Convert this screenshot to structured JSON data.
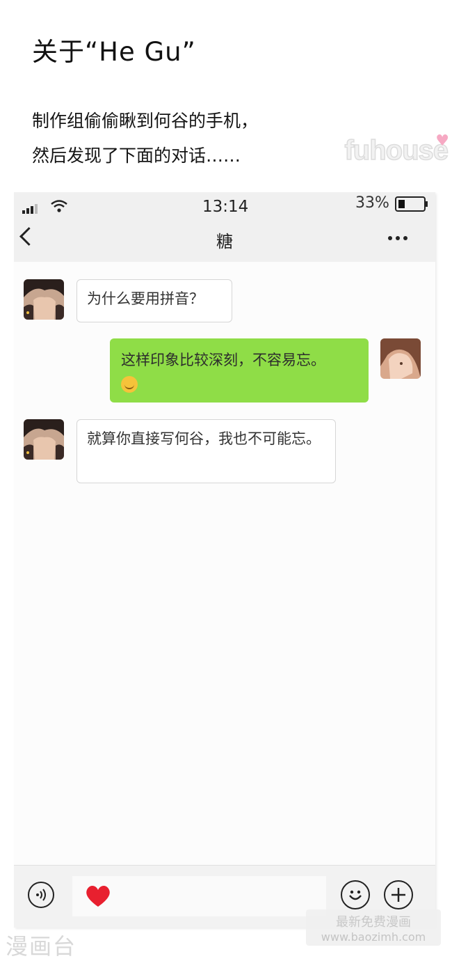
{
  "header": {
    "title": "关于“He Gu”",
    "intro_line1": "制作组偷偷瞅到何谷的手机，",
    "intro_line2": "然后发现了下面的对话……",
    "watermark": "fuhouse"
  },
  "phone": {
    "status": {
      "time": "13:14",
      "battery": "33%",
      "battery_level": 0.33
    },
    "chat_title": "糖",
    "messages": [
      {
        "side": "left",
        "text": "为什么要用拼音？"
      },
      {
        "side": "right",
        "text": "这样印象比较深刻，不容易忘。",
        "emoji": "smile-emoji"
      },
      {
        "side": "left",
        "text": "就算你直接写何谷，我也不可能忘。"
      }
    ],
    "icons": {
      "voice": "voice-icon",
      "sticker": "heart-icon",
      "emoji": "emoji-icon",
      "add": "plus-icon"
    }
  },
  "watermarks": {
    "bottom_left": "漫画台",
    "bottom_right_line1": "最新免费漫画",
    "bottom_right_line2": "www.baozimh.com"
  },
  "colors": {
    "sent_bubble": "#8fdd47",
    "received_bubble": "#ffffff",
    "heart": "#e8202f"
  }
}
